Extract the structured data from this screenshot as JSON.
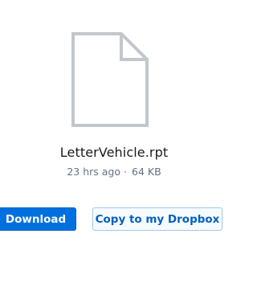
{
  "file": {
    "name": "LetterVehicle.rpt",
    "modified": "23 hrs ago",
    "separator": "·",
    "size": "64 KB",
    "icon": "generic-file-icon"
  },
  "actions": {
    "download_label": "Download",
    "copy_label": "Copy to my Dropbox"
  },
  "colors": {
    "primary": "#0070e0",
    "link": "#0061c2",
    "icon_stroke": "#c1c7cd",
    "meta_text": "#637282"
  }
}
